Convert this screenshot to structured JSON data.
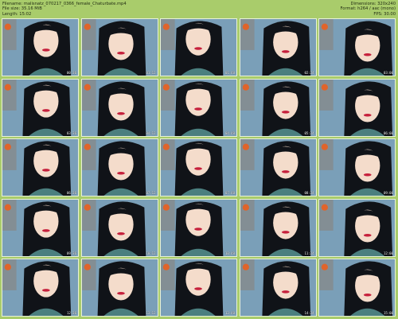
{
  "header": {
    "filename": "Filename:   malisnatz_070217_0366_female_Chaturbate.mp4",
    "filesize": "File size:  35.16 MiB",
    "length": "Length: 15:02",
    "dimensions": "Dimensions: 320x240",
    "format": "Format: h264 / aac (mono)",
    "fps": "FPS: 30.00"
  },
  "thumbnails": [
    {
      "time": "00:36"
    },
    {
      "time": "01:12"
    },
    {
      "time": "01:48"
    },
    {
      "time": "02:24"
    },
    {
      "time": "03:00"
    },
    {
      "time": "03:36"
    },
    {
      "time": "04:12"
    },
    {
      "time": "04:48"
    },
    {
      "time": "05:24"
    },
    {
      "time": "06:00"
    },
    {
      "time": "06:36"
    },
    {
      "time": "07:12"
    },
    {
      "time": "07:48"
    },
    {
      "time": "08:24"
    },
    {
      "time": "09:00"
    },
    {
      "time": "09:36"
    },
    {
      "time": "10:12"
    },
    {
      "time": "10:48"
    },
    {
      "time": "11:24"
    },
    {
      "time": "12:00"
    },
    {
      "time": "12:36"
    },
    {
      "time": "13:12"
    },
    {
      "time": "13:48"
    },
    {
      "time": "14:24"
    },
    {
      "time": "15:00"
    }
  ],
  "colors": {
    "background": "#a9cc6b",
    "hair": "#101318",
    "skin": "#f4dccb",
    "lips": "#c6203c"
  }
}
